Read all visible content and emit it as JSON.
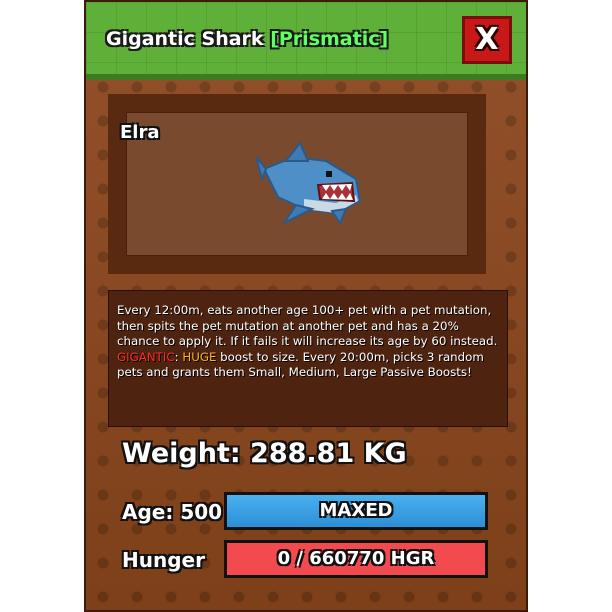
{
  "window": {
    "title": "Gigantic Shark",
    "tag": "[Prismatic]",
    "close_label": "X"
  },
  "pet": {
    "name": "Elra",
    "image": "shark-icon"
  },
  "description": {
    "line1": "Every 12:00m, eats another age 100+ pet with a pet mutation, then spits the pet mutation at another pet and has a 20% chance to apply it. If it fails it will increase its age by 60 instead.",
    "gigantic_word": "GIGANTIC",
    "sep": ": ",
    "huge_word": "HUGE",
    "line2_rest": " boost to size. Every 20:00m, picks 3 random pets and grants them Small, Medium, Large Passive Boosts!"
  },
  "stats": {
    "weight": "Weight: 288.81 KG",
    "age_label": "Age: 500",
    "age_bar_text": "MAXED",
    "age_fraction": 1.0,
    "hunger_label": "Hunger",
    "hunger_bar_text": "0 / 660770 HGR",
    "hunger_fraction": 0.0
  },
  "colors": {
    "header_green": "#5fb038",
    "panel_brown": "#8a4a22",
    "close_red": "#c81818",
    "age_bar_blue": "#2c8fd8",
    "hunger_bar_red": "#f24a4e",
    "prismatic_green": "#62ff62",
    "gigantic_red": "#ff2b2b",
    "huge_orange": "#ffb020"
  }
}
